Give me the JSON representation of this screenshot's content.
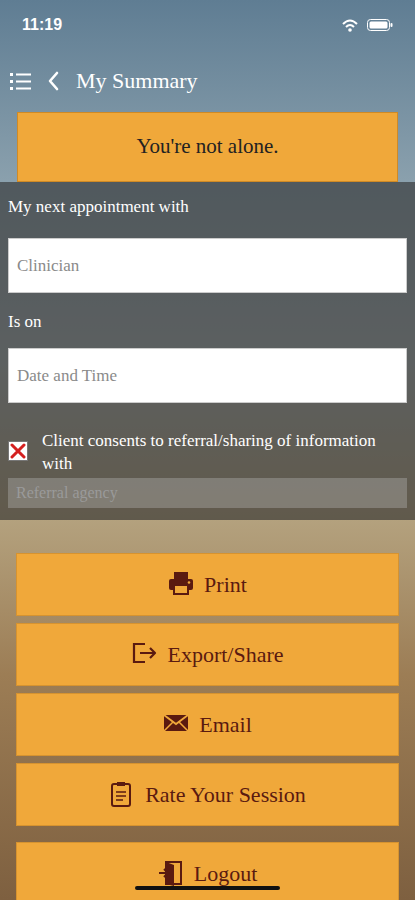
{
  "status_bar": {
    "time": "11:19"
  },
  "header": {
    "title": "My Summary"
  },
  "banner": "You're not alone.",
  "form": {
    "clinician": {
      "label": "My next appointment with",
      "placeholder": "Clinician"
    },
    "date": {
      "label": "Is on",
      "placeholder": "Date and Time"
    },
    "consent": {
      "label": "Client consents to referral/sharing of information with",
      "checked": true
    },
    "referral": {
      "placeholder": "Referral agency",
      "disabled": true
    }
  },
  "buttons": [
    {
      "label": "Print",
      "kind": "print"
    },
    {
      "label": "Export/Share",
      "kind": "export"
    },
    {
      "label": "Email",
      "kind": "email"
    },
    {
      "label": "Rate Your Session",
      "kind": "rate"
    },
    {
      "label": "Logout",
      "kind": "logout"
    }
  ]
}
